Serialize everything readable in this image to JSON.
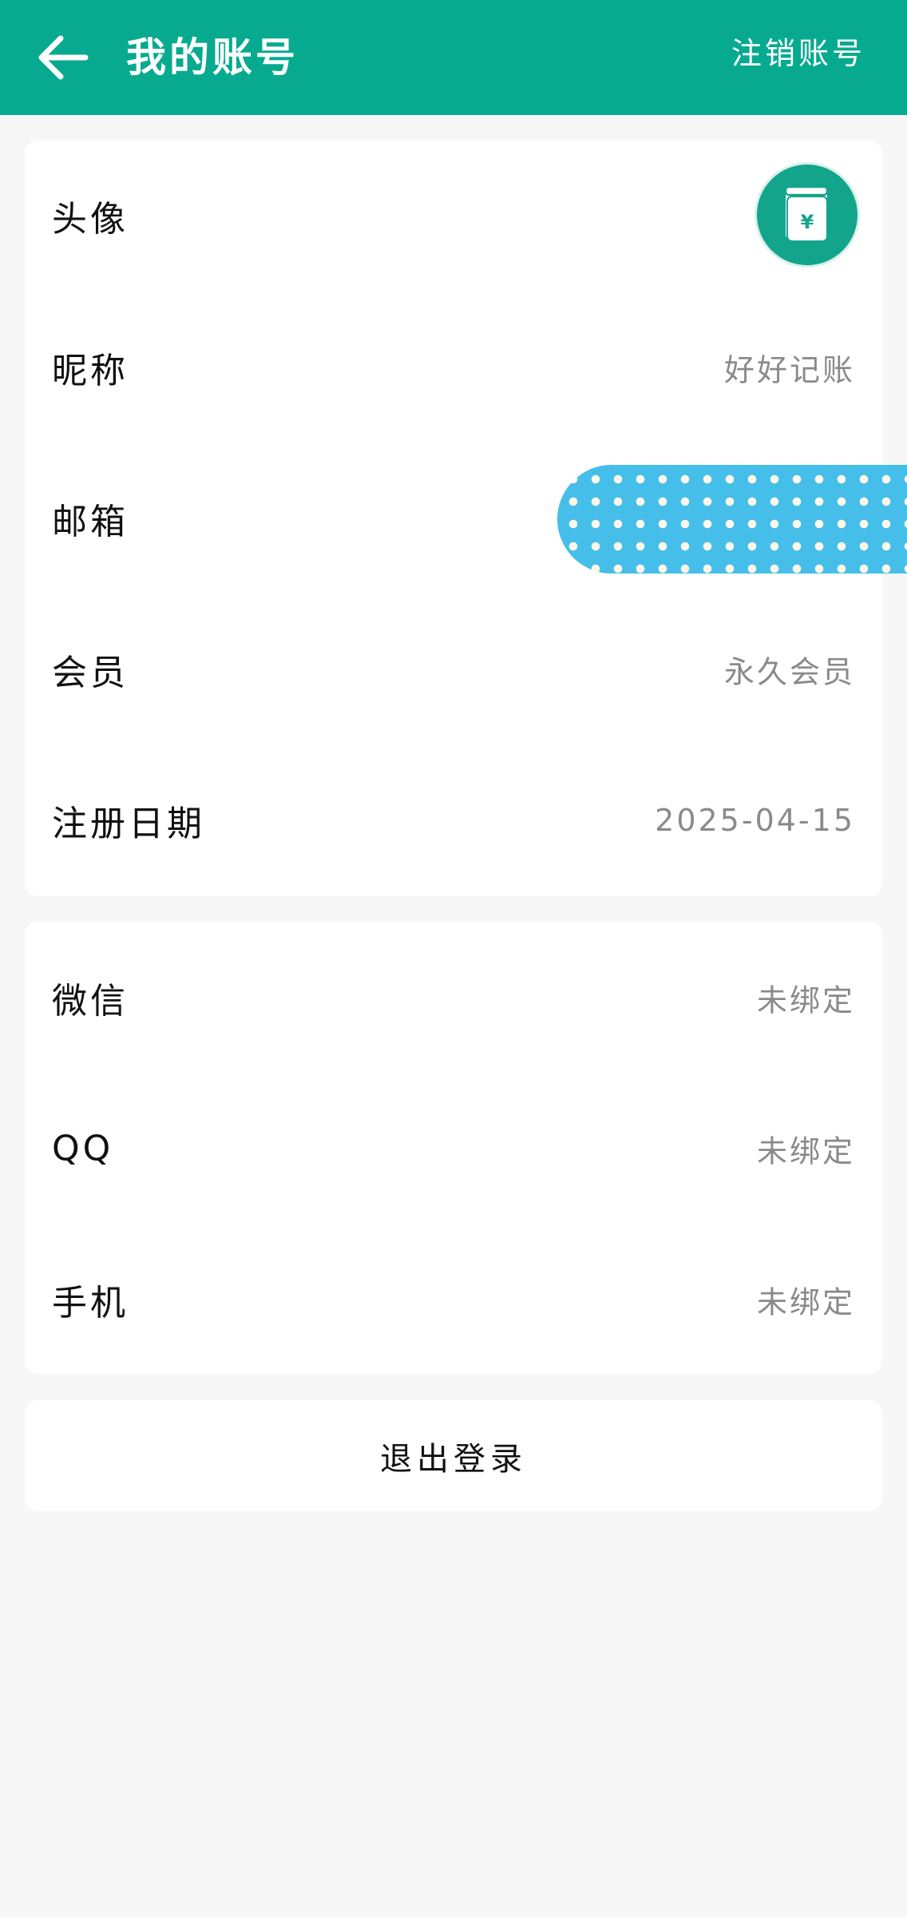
{
  "header": {
    "title": "我的账号",
    "right_action": "注销账号",
    "back_icon": "arrow-left-icon",
    "background": "#07aa8f"
  },
  "profile": {
    "avatar": {
      "label": "头像",
      "icon": "ledger-book-yen-icon",
      "color": "#13a58c"
    },
    "nickname": {
      "label": "昵称",
      "value": "好好记账"
    },
    "email": {
      "label": "邮箱",
      "value": ""
    },
    "membership": {
      "label": "会员",
      "value": "永久会员"
    },
    "register_date": {
      "label": "注册日期",
      "value": "2025-04-15"
    }
  },
  "bindings": {
    "wechat": {
      "label": "微信",
      "value": "未绑定"
    },
    "qq": {
      "label": "QQ",
      "value": "未绑定"
    },
    "phone": {
      "label": "手机",
      "value": "未绑定"
    }
  },
  "logout": {
    "label": "退出登录"
  },
  "colors": {
    "accent": "#07aa8f",
    "page_bg": "#f7f7f7",
    "sticker": "#45bfe9",
    "value_text": "#8a8a8a"
  }
}
